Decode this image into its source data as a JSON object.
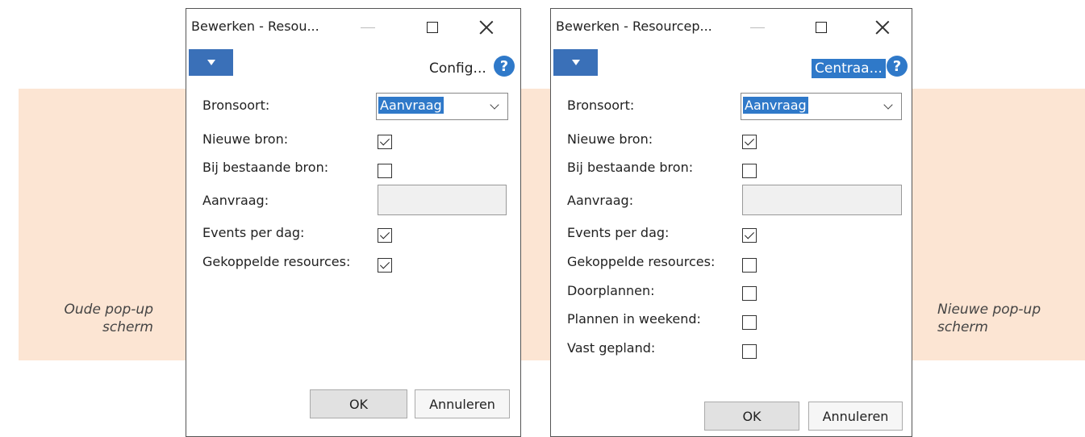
{
  "captions": {
    "old": "Oude pop-up scherm",
    "new": "Nieuwe pop-up scherm"
  },
  "old_window": {
    "title": "Bewerken - Resou...",
    "header_action": "Config...",
    "help_glyph": "?",
    "fields": {
      "bronsoort_label": "Bronsoort:",
      "bronsoort_value": "Aanvraag",
      "nieuwe_bron_label": "Nieuwe bron:",
      "nieuwe_bron_checked": true,
      "bij_bestaande_label": "Bij bestaande bron:",
      "bij_bestaande_checked": false,
      "aanvraag_label": "Aanvraag:",
      "aanvraag_value": "",
      "events_label": "Events per dag:",
      "events_checked": true,
      "gekoppelde_label": "Gekoppelde resources:",
      "gekoppelde_checked": true
    },
    "ok_label": "OK",
    "cancel_label": "Annuleren"
  },
  "new_window": {
    "title": "Bewerken - Resourcep...",
    "header_action": "Centraa...",
    "help_glyph": "?",
    "fields": {
      "bronsoort_label": "Bronsoort:",
      "bronsoort_value": "Aanvraag",
      "nieuwe_bron_label": "Nieuwe bron:",
      "nieuwe_bron_checked": true,
      "bij_bestaande_label": "Bij bestaande bron:",
      "bij_bestaande_checked": false,
      "aanvraag_label": "Aanvraag:",
      "aanvraag_value": "",
      "events_label": "Events per dag:",
      "events_checked": true,
      "gekoppelde_label": "Gekoppelde resources:",
      "gekoppelde_checked": false,
      "doorplannen_label": "Doorplannen:",
      "doorplannen_checked": false,
      "weekend_label": "Plannen in weekend:",
      "weekend_checked": false,
      "vast_label": "Vast gepland:",
      "vast_checked": false
    },
    "ok_label": "OK",
    "cancel_label": "Annuleren"
  },
  "icons": [
    "minimize-icon",
    "maximize-icon",
    "close-icon",
    "menu-dropdown-icon",
    "help-icon",
    "chevron-down-icon",
    "checkbox-icon"
  ],
  "colors": {
    "accent": "#2f79c9",
    "menu_button": "#3a70b8",
    "background_band": "#fce5d3"
  }
}
